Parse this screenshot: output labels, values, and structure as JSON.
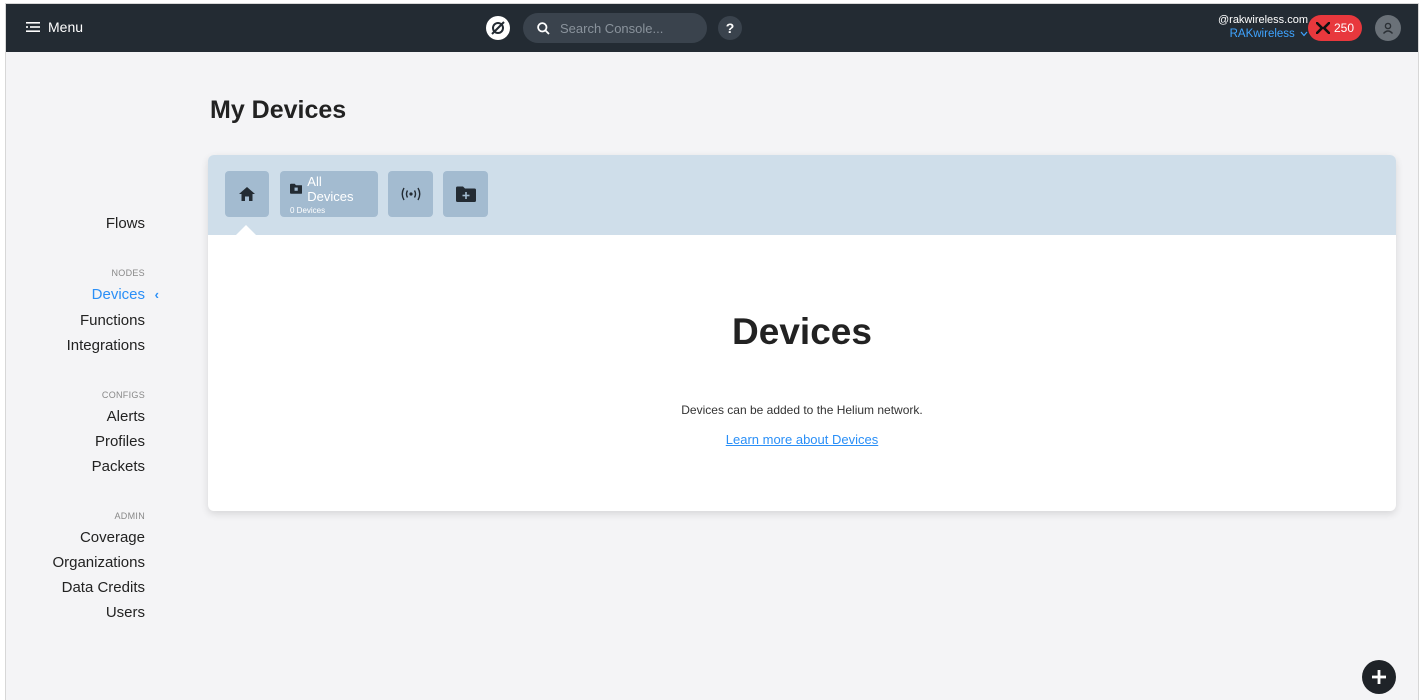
{
  "topbar": {
    "menu_label": "Menu",
    "search_placeholder": "Search Console...",
    "help_label": "?",
    "account_email": "@rakwireless.com",
    "org_name": "RAKwireless",
    "data_credits": "250"
  },
  "sidebar": {
    "top_items": [
      {
        "label": "Flows"
      }
    ],
    "sections": [
      {
        "title": "NODES",
        "items": [
          {
            "label": "Devices",
            "active": true
          },
          {
            "label": "Functions"
          },
          {
            "label": "Integrations"
          }
        ]
      },
      {
        "title": "CONFIGS",
        "items": [
          {
            "label": "Alerts"
          },
          {
            "label": "Profiles"
          },
          {
            "label": "Packets"
          }
        ]
      },
      {
        "title": "ADMIN",
        "items": [
          {
            "label": "Coverage"
          },
          {
            "label": "Organizations"
          },
          {
            "label": "Data Credits"
          },
          {
            "label": "Users"
          }
        ]
      }
    ]
  },
  "main": {
    "page_title": "My Devices",
    "toolbar": {
      "all_devices_label": "All Devices",
      "all_devices_count": "0 Devices"
    },
    "empty_state": {
      "title": "Devices",
      "description": "Devices can be added to the Helium network.",
      "link_text": "Learn more about Devices"
    }
  },
  "colors": {
    "topbar_bg": "#232b33",
    "accent": "#2a8ff7",
    "badge_red": "#e8383d",
    "toolbar_bg": "#cfdeea",
    "toolbar_button": "#a3bbd0"
  },
  "icons": [
    "menu-icon",
    "helium-logo-icon",
    "search-icon",
    "help-icon",
    "chevron-down-icon",
    "helium-x-icon",
    "user-icon",
    "home-icon",
    "folder-icon",
    "signal-icon",
    "add-folder-icon",
    "plus-icon"
  ]
}
